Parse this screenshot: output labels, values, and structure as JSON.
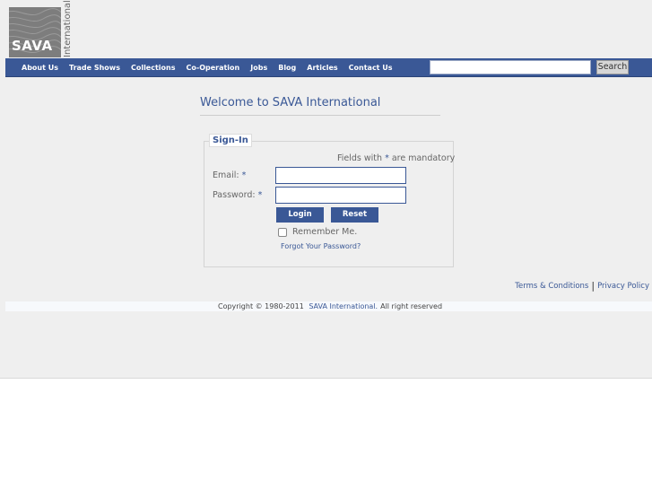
{
  "logo": {
    "text": "SAVA",
    "side_text": "International"
  },
  "nav": {
    "items": [
      "About Us",
      "Trade Shows",
      "Collections",
      "Co-Operation",
      "Jobs",
      "Blog",
      "Articles",
      "Contact Us"
    ],
    "search_button": "Search",
    "search_value": ""
  },
  "main": {
    "welcome": "Welcome to SAVA International",
    "signin": {
      "legend": "Sign-In",
      "mandatory_prefix": "Fields with ",
      "mandatory_star": "*",
      "mandatory_suffix": " are mandatory",
      "email_label": "Email:",
      "password_label": "Password:",
      "required_star": "*",
      "email_value": "",
      "password_value": "",
      "login_button": "Login",
      "reset_button": "Reset",
      "remember_label": "Remember Me.",
      "remember_checked": false,
      "forgot_link": "Forgot Your Password?"
    }
  },
  "footer": {
    "terms": "Terms & Conditions",
    "separator": "|",
    "privacy": "Privacy Policy",
    "copyright_prefix": "Copyright © 1980-2011",
    "copyright_brand": "SAVA International.",
    "copyright_suffix": "All right reserved"
  },
  "colors": {
    "accent": "#3a5896",
    "background": "#efefef",
    "logo_gray": "#7d7d7d"
  }
}
